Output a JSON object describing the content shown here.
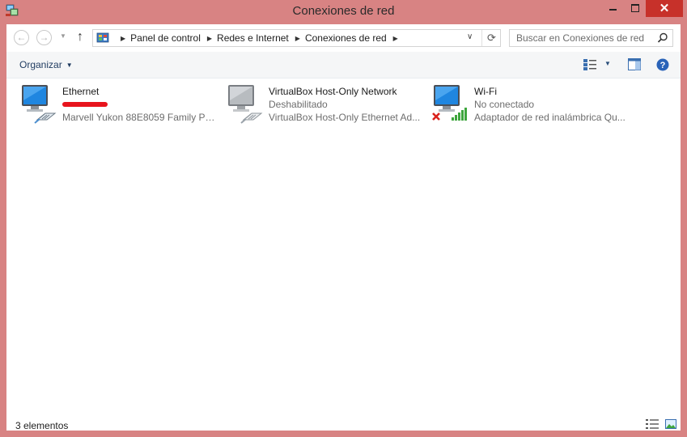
{
  "window": {
    "title": "Conexiones de red"
  },
  "titlebar_buttons": {
    "close": "✕"
  },
  "nav": {
    "back": "←",
    "forward": "→",
    "up": "↑",
    "breadcrumbs": [
      "Panel de control",
      "Redes e Internet",
      "Conexiones de red"
    ],
    "search_placeholder": "Buscar en Conexiones de red"
  },
  "toolbar": {
    "organize": "Organizar"
  },
  "connections": [
    {
      "name": "Ethernet",
      "status": "",
      "device": "Marvell Yukon 88E8059 Family PC...",
      "type": "wired"
    },
    {
      "name": "VirtualBox Host-Only Network",
      "status": "Deshabilitado",
      "device": "VirtualBox Host-Only Ethernet Ad...",
      "type": "wired-disabled"
    },
    {
      "name": "Wi-Fi",
      "status": "No conectado",
      "device": "Adaptador de red inalámbrica Qu...",
      "type": "wireless-disconnected"
    }
  ],
  "statusbar": {
    "count": "3 elementos"
  },
  "colors": {
    "frame": "#d88383",
    "close": "#c7312a",
    "accent": "#1e3a5f"
  }
}
